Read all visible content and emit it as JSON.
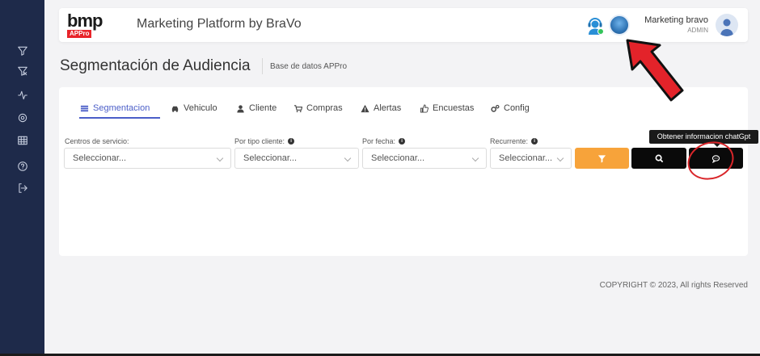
{
  "header": {
    "logo_text": "bmp",
    "logo_badge": "APPro",
    "title": "Marketing Platform by BraVo",
    "user_name": "Marketing bravo",
    "user_role": "ADMIN"
  },
  "page": {
    "title": "Segmentación de Audiencia",
    "subtitle": "Base de datos APPro"
  },
  "sidebar": {
    "icons": [
      "filter-icon",
      "filter-remove-icon",
      "activity-icon",
      "settings-icon",
      "table-icon",
      "help-icon",
      "logout-icon"
    ]
  },
  "tabs": [
    {
      "label": "Segmentacion",
      "icon": "list-icon",
      "active": true
    },
    {
      "label": "Vehiculo",
      "icon": "car-icon"
    },
    {
      "label": "Cliente",
      "icon": "user-icon"
    },
    {
      "label": "Compras",
      "icon": "cart-icon"
    },
    {
      "label": "Alertas",
      "icon": "warning-icon"
    },
    {
      "label": "Encuestas",
      "icon": "thumbs-up-icon"
    },
    {
      "label": "Config",
      "icon": "gears-icon"
    }
  ],
  "filters": [
    {
      "label": "Centros de servicio:",
      "placeholder": "Seleccionar..."
    },
    {
      "label": "Por tipo cliente:",
      "placeholder": "Seleccionar..."
    },
    {
      "label": "Por fecha:",
      "placeholder": "Seleccionar..."
    },
    {
      "label": "Recurrente:",
      "placeholder": "Seleccionar..."
    }
  ],
  "tooltip": "Obtener informacion chatGpt",
  "footer": {
    "copyright": "COPYRIGHT © 2023, All rights Reserved"
  },
  "colors": {
    "sidebar": "#1e2a4a",
    "accent": "#4b5ec8",
    "filter_button": "#f7a33a",
    "annotation": "#d9262a"
  }
}
